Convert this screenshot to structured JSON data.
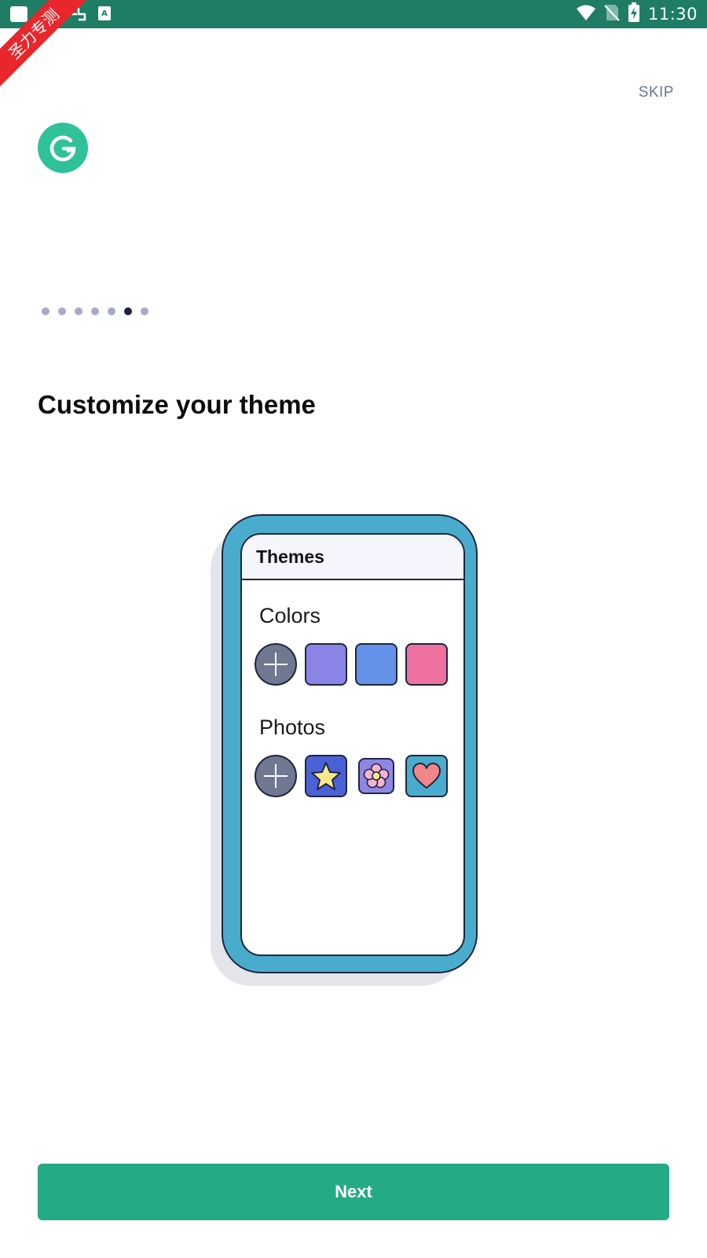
{
  "status_bar": {
    "time": "11:30",
    "left_icons": [
      "notification-icon",
      "app-icon",
      "keyboard-icon"
    ],
    "right_icons": [
      "wifi-icon",
      "no-sim-icon",
      "battery-charging-icon"
    ]
  },
  "ribbon": {
    "text": "圣力专测"
  },
  "header": {
    "skip_label": "SKIP",
    "logo_icon": "grammarly-logo-icon"
  },
  "pager": {
    "total_pages": 7,
    "current_page": 6
  },
  "main": {
    "title": "Customize your theme"
  },
  "illustration": {
    "header_title": "Themes",
    "colors_label": "Colors",
    "photos_label": "Photos",
    "color_swatches": [
      "#8a84e6",
      "#6492e8",
      "#ee719f"
    ],
    "photo_swatches": [
      {
        "icon": "star-icon",
        "bg": "#4b62d6"
      },
      {
        "icon": "flower-icon",
        "bg": "#8f86e4"
      },
      {
        "icon": "heart-icon",
        "bg": "#4aaccd"
      }
    ]
  },
  "footer": {
    "next_label": "Next"
  },
  "colors": {
    "status_bar": "#1e7d64",
    "accent": "#25aa86",
    "logo": "#2fc19a",
    "phone_frame": "#4aaccd"
  }
}
